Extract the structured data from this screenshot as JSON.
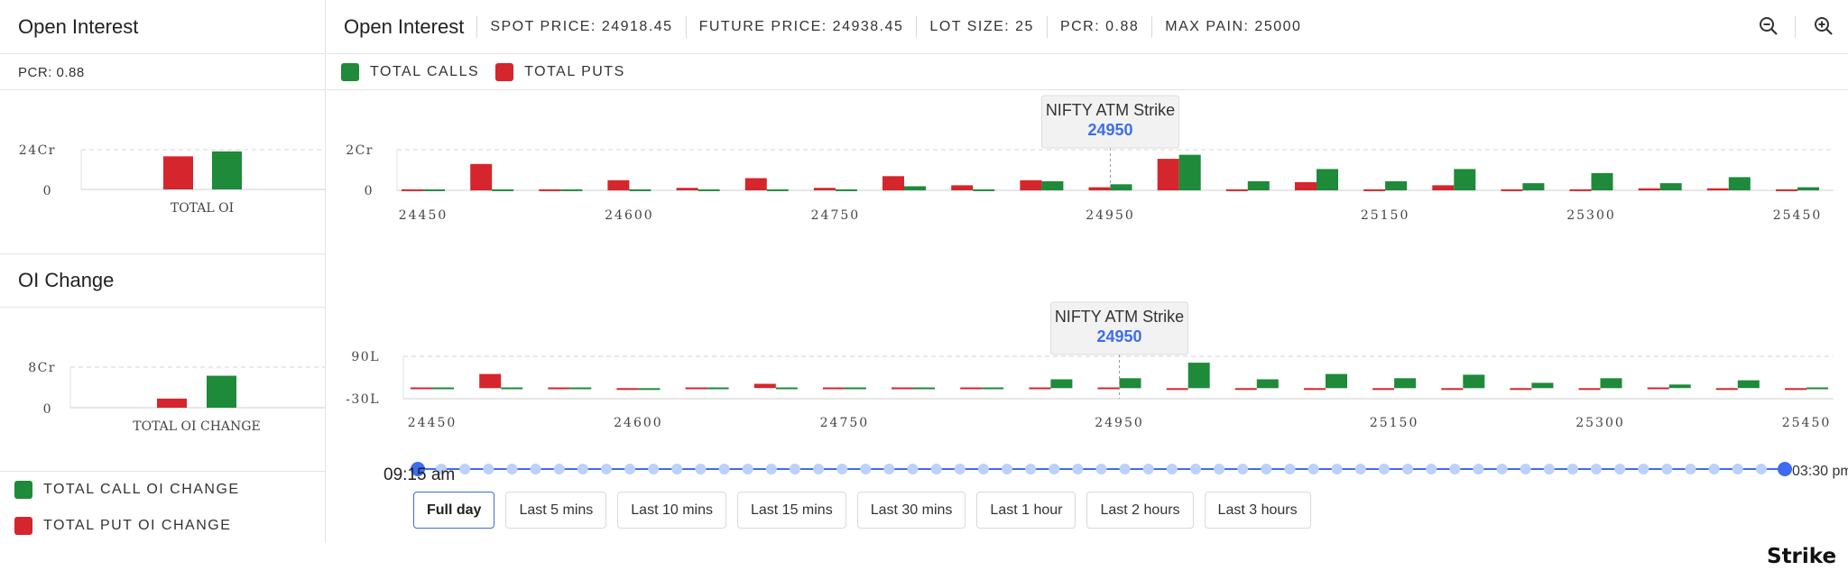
{
  "colors": {
    "calls": "#1e8a3a",
    "puts": "#d4262c",
    "accent": "#3d6cf0",
    "slider_dot": "#bcd1fb"
  },
  "left": {
    "open_interest_title": "Open Interest",
    "pcr_label": "PCR: 0.88",
    "oi_change_title": "OI Change",
    "legend": [
      "TOTAL CALL OI CHANGE",
      "TOTAL PUT OI CHANGE"
    ]
  },
  "header": {
    "title": "Open Interest",
    "stats": [
      "SPOT PRICE: 24918.45",
      "FUTURE PRICE: 24938.45",
      "LOT SIZE: 25",
      "PCR: 0.88",
      "MAX PAIN: 25000"
    ],
    "zoom_out_icon": "zoom-out-icon",
    "zoom_in_icon": "zoom-in-icon"
  },
  "legend": [
    "TOTAL CALLS",
    "TOTAL PUTS"
  ],
  "tooltip": {
    "title": "NIFTY ATM Strike",
    "value": "24950"
  },
  "slider": {
    "start_label": "09:15 am",
    "end_label": "03:30 pm",
    "dot_count": 59
  },
  "range_buttons": [
    "Full day",
    "Last 5 mins",
    "Last 10 mins",
    "Last 15 mins",
    "Last 30 mins",
    "Last 1 hour",
    "Last 2 hours",
    "Last 3 hours"
  ],
  "brand": "Strike",
  "chart_data": [
    {
      "type": "bar",
      "categories": [
        "TOTAL OI"
      ],
      "series": [
        {
          "name": "TOTAL PUTS",
          "values": [
            20
          ]
        },
        {
          "name": "TOTAL CALLS",
          "values": [
            23
          ]
        }
      ],
      "yticks": [
        "0",
        "24Cr"
      ],
      "ylim": [
        0,
        24
      ],
      "grid": true
    },
    {
      "type": "bar",
      "categories": [
        "TOTAL OI CHANGE"
      ],
      "series": [
        {
          "name": "TOTAL PUT OI CHANGE",
          "values": [
            1.8
          ]
        },
        {
          "name": "TOTAL CALL OI CHANGE",
          "values": [
            6.3
          ]
        }
      ],
      "yticks": [
        "0",
        "8Cr"
      ],
      "ylim": [
        0,
        8
      ],
      "grid": true
    },
    {
      "type": "bar",
      "strikes": [
        24450,
        24500,
        24550,
        24600,
        24650,
        24700,
        24750,
        24800,
        24850,
        24900,
        24950,
        25000,
        25050,
        25100,
        25150,
        25200,
        25250,
        25300,
        25350,
        25400,
        25450
      ],
      "xtick_labels": [
        "24450",
        "24600",
        "24750",
        "24950",
        "25150",
        "25300",
        "25450"
      ],
      "series": [
        {
          "name": "TOTAL PUTS",
          "values": [
            0.05,
            1.3,
            0.05,
            0.5,
            0.12,
            0.6,
            0.12,
            0.7,
            0.25,
            0.5,
            0.15,
            1.55,
            0.05,
            0.4,
            0.05,
            0.25,
            0.05,
            0.05,
            0.1,
            0.1,
            0.05
          ]
        },
        {
          "name": "TOTAL CALLS",
          "values": [
            0.05,
            0.05,
            0.05,
            0.05,
            0.05,
            0.05,
            0.05,
            0.2,
            0.05,
            0.45,
            0.3,
            1.75,
            0.45,
            1.05,
            0.45,
            1.05,
            0.35,
            0.85,
            0.35,
            0.65,
            0.15
          ]
        }
      ],
      "yticks": [
        "0",
        "2Cr"
      ],
      "ylim": [
        0,
        2
      ],
      "grid": true
    },
    {
      "type": "bar",
      "strikes": [
        24450,
        24500,
        24550,
        24600,
        24650,
        24700,
        24750,
        24800,
        24850,
        24900,
        24950,
        25000,
        25050,
        25100,
        25150,
        25200,
        25250,
        25300,
        25350,
        25400,
        25450
      ],
      "xtick_labels": [
        "24450",
        "24600",
        "24750",
        "24950",
        "25150",
        "25300",
        "25450"
      ],
      "series": [
        {
          "name": "TOTAL PUT OI CHANGE",
          "values": [
            2,
            40,
            2,
            -2,
            2,
            12,
            2,
            2,
            2,
            2,
            2,
            -3,
            -3,
            -3,
            -3,
            -3,
            -3,
            -3,
            2,
            -3,
            -3
          ]
        },
        {
          "name": "TOTAL CALL OI CHANGE",
          "values": [
            2,
            2,
            2,
            -2,
            2,
            2,
            2,
            2,
            2,
            25,
            28,
            72,
            25,
            40,
            28,
            38,
            15,
            28,
            10,
            22,
            2
          ]
        }
      ],
      "yticks": [
        "-30L",
        "90L"
      ],
      "ylim": [
        -30,
        90
      ],
      "grid": true
    }
  ]
}
